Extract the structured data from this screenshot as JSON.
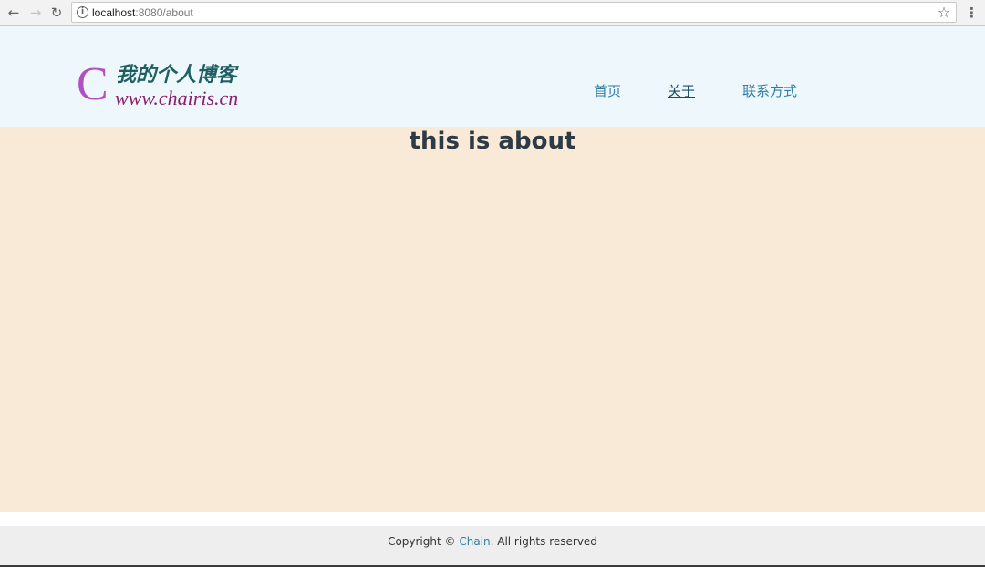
{
  "browser": {
    "back_glyph": "←",
    "forward_glyph": "→",
    "reload_glyph": "↻",
    "info_glyph": "i",
    "url_host": "localhost",
    "url_rest": ":8080/about",
    "star_glyph": "☆",
    "menu_glyph": "⋮",
    "icons": [
      "back-arrow-icon",
      "forward-arrow-icon",
      "reload-icon",
      "info-icon",
      "star-icon",
      "menu-icon"
    ]
  },
  "header": {
    "logo": {
      "letter": "C",
      "title": "我的个人博客",
      "url": "www.chairis.cn"
    },
    "nav": [
      {
        "label": "首页"
      },
      {
        "label": "关于"
      },
      {
        "label": "联系方式"
      }
    ],
    "active_index": 1
  },
  "main": {
    "heading": "this is about"
  },
  "footer": {
    "prefix": "Copyright © ",
    "link": "Chain",
    "suffix": ". All rights reserved"
  },
  "colors": {
    "header_bg": "#eef7fc",
    "content_bg": "#f9ead8",
    "footer_bg": "#eeeeee",
    "nav_link": "#2e7ea3",
    "logo_c": "#b14fc5",
    "logo_title": "#1e5f62",
    "logo_url": "#8a1f6e"
  }
}
